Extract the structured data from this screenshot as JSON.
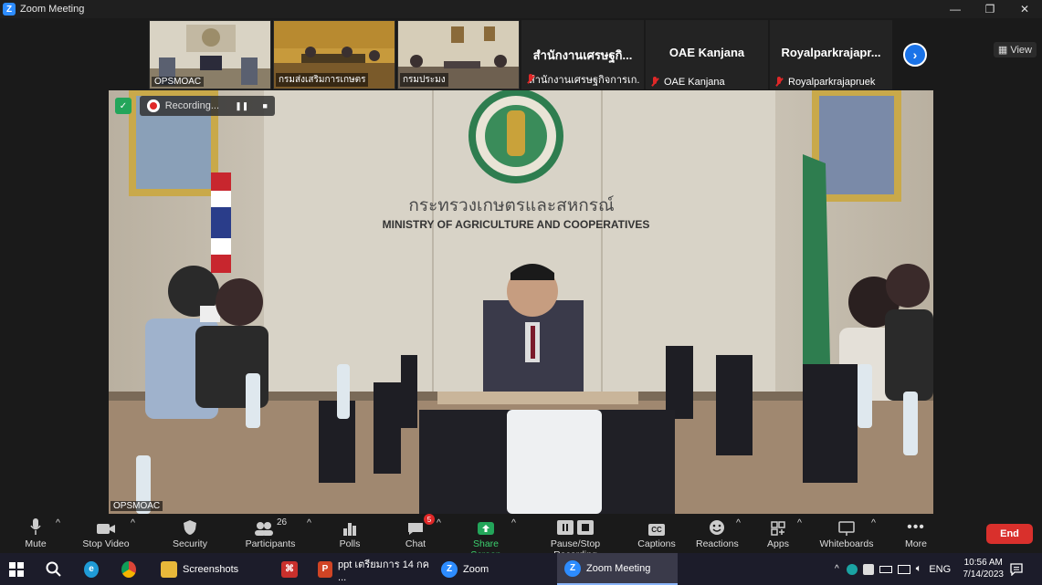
{
  "window": {
    "title": "Zoom Meeting",
    "controls": [
      "—",
      "❐",
      "✕"
    ]
  },
  "gallery": {
    "video_thumbs": [
      {
        "name": "OPSMOAC"
      },
      {
        "name": "กรมส่งเสริมการเกษตร"
      },
      {
        "name": "กรมประมง"
      }
    ],
    "name_tiles": [
      {
        "display": "สำนักงานเศรษฐกิ...",
        "name": "สำนักงานเศรษฐกิจการเก..."
      },
      {
        "display": "OAE Kanjana",
        "name": "OAE Kanjana"
      },
      {
        "display": "Royalparkrajapr...",
        "name": "Royalparkrajapruek"
      }
    ],
    "next_icon": "chevron-right",
    "view_label": "View"
  },
  "main": {
    "speaker_label": "OPSMOAC",
    "recording_label": "Recording...",
    "scene": {
      "sign_thai": "กระทรวงเกษตรและสหกรณ์",
      "sign_en": "MINISTRY OF AGRICULTURE AND COOPERATIVES"
    }
  },
  "toolbar": {
    "items": [
      {
        "label": "Mute",
        "icon": "microphone-icon",
        "caret": true
      },
      {
        "label": "Stop Video",
        "icon": "video-camera-icon",
        "caret": true
      },
      {
        "label": "Security",
        "icon": "shield-icon",
        "caret": false
      },
      {
        "label": "Participants",
        "icon": "participants-icon",
        "count": "26",
        "caret": true
      },
      {
        "label": "Polls",
        "icon": "polls-icon",
        "caret": false
      },
      {
        "label": "Chat",
        "icon": "chat-icon",
        "badge": "5",
        "caret": true
      },
      {
        "label": "Share Screen",
        "icon": "share-screen-icon",
        "caret": true
      },
      {
        "label": "Pause/Stop Recording",
        "icon": "pause-stop-icon",
        "caret": false
      },
      {
        "label": "Captions",
        "icon": "captions-icon",
        "icon_text": "CC",
        "caret": false
      },
      {
        "label": "Reactions",
        "icon": "reactions-icon",
        "caret": true
      },
      {
        "label": "Apps",
        "icon": "apps-icon",
        "caret": true
      },
      {
        "label": "Whiteboards",
        "icon": "whiteboard-icon",
        "caret": true
      },
      {
        "label": "More",
        "icon": "more-icon",
        "caret": false
      }
    ],
    "end_label": "End"
  },
  "taskbar": {
    "apps": [
      {
        "label": "Screenshots",
        "icon": "folder-icon"
      },
      {
        "label": "",
        "icon": "pdf-icon"
      },
      {
        "label": "ppt เตรียมการ 14 กค ...",
        "icon": "powerpoint-icon"
      },
      {
        "label": "Zoom",
        "icon": "zoom-icon"
      },
      {
        "label": "Zoom Meeting",
        "icon": "zoom-icon"
      }
    ],
    "lang": "ENG",
    "time": "10:56 AM",
    "date": "7/14/2023"
  },
  "colors": {
    "accent": "#2d8cff",
    "end": "#d9302c",
    "share": "#23a55a",
    "muted": "#e02828"
  }
}
